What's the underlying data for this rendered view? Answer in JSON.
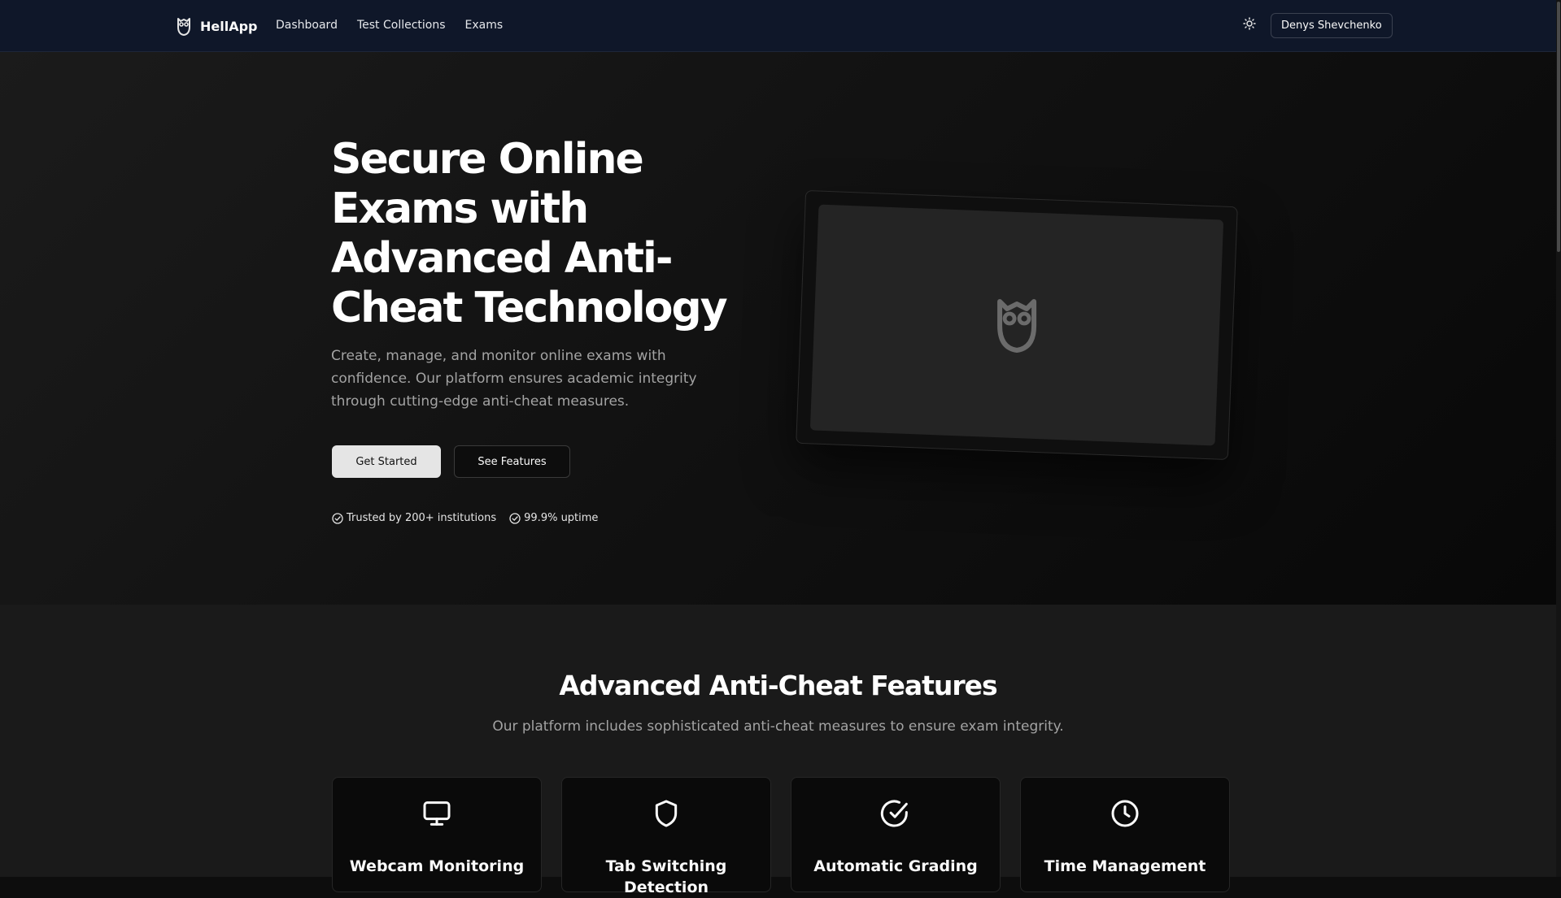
{
  "navbar": {
    "brand": "HellApp",
    "brand_icon": "owl-logo-icon",
    "links": [
      {
        "label": "Dashboard"
      },
      {
        "label": "Test Collections"
      },
      {
        "label": "Exams"
      }
    ],
    "theme_icon": "sun-icon",
    "user_name": "Denys Shevchenko"
  },
  "hero": {
    "title": "Secure Online Exams with Advanced Anti-Cheat Technology",
    "description": "Create, manage, and monitor online exams with confidence. Our platform ensures academic integrity through cutting-edge anti-cheat measures.",
    "primary_button": "Get Started",
    "secondary_button": "See Features",
    "trust_badges": [
      {
        "icon": "check-circle-icon",
        "text": "Trusted by 200+ institutions"
      },
      {
        "icon": "check-circle-icon",
        "text": "99.9% uptime"
      }
    ],
    "illustration_icon": "owl-logo-icon"
  },
  "features": {
    "title": "Advanced Anti-Cheat Features",
    "subtitle": "Our platform includes sophisticated anti-cheat measures to ensure exam integrity.",
    "cards": [
      {
        "icon": "monitor-icon",
        "title": "Webcam Monitoring"
      },
      {
        "icon": "shield-icon",
        "title": "Tab Switching Detection"
      },
      {
        "icon": "check-circle-icon",
        "title": "Automatic Grading"
      },
      {
        "icon": "clock-icon",
        "title": "Time Management"
      }
    ]
  },
  "colors": {
    "navbar_bg": "#0f1729",
    "page_bg": "#0d0d0d",
    "section_bg": "#1a1a1a",
    "card_bg": "#0a0a0a",
    "primary_button_bg": "#e5e5e5",
    "muted_text": "#a3a3a3"
  }
}
